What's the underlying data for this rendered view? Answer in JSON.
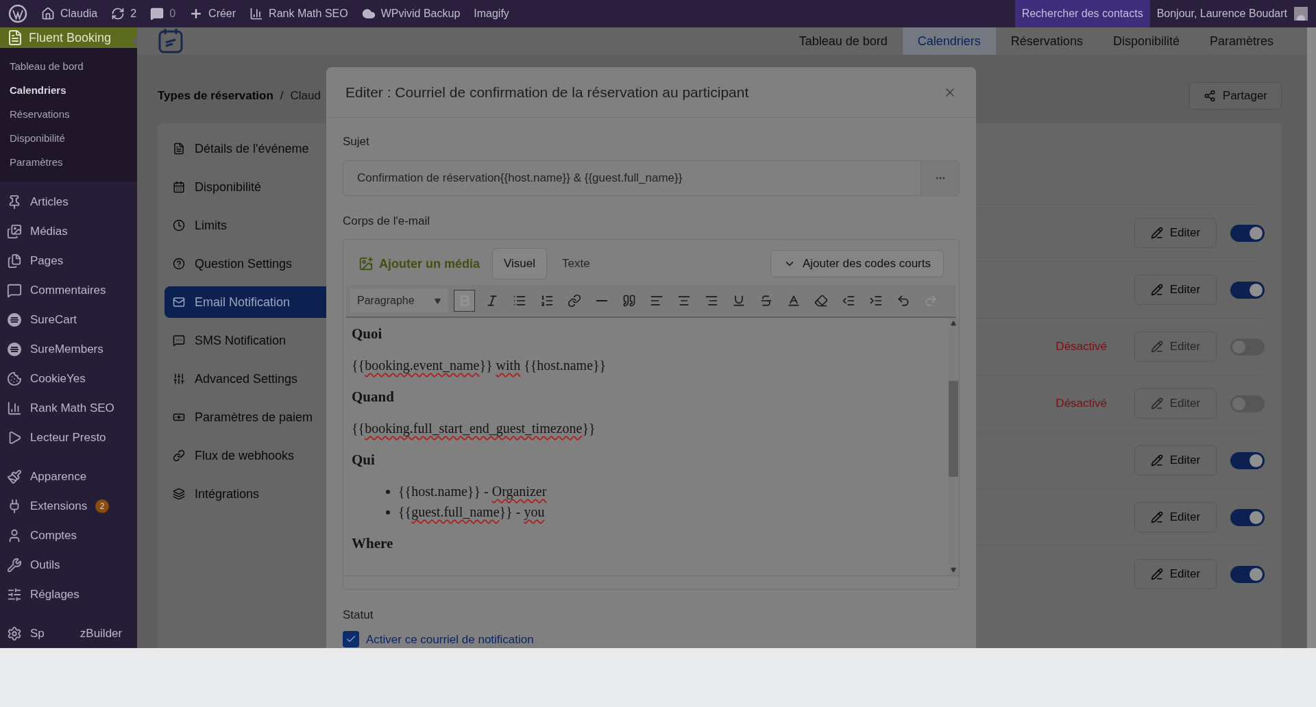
{
  "admin_bar": {
    "site": "Claudia",
    "updates": "2",
    "comments": "0",
    "create": "Créer",
    "plugins": [
      "Rank Math SEO",
      "WPvivid Backup",
      "Imagify"
    ],
    "search_contacts": "Rechercher des contacts",
    "greeting": "Bonjour, Laurence Boudart"
  },
  "sidebar": {
    "plugin": "Fluent Booking",
    "submenu": [
      {
        "label": "Tableau de bord",
        "selected": false
      },
      {
        "label": "Calendriers",
        "selected": true
      },
      {
        "label": "Réservations",
        "selected": false
      },
      {
        "label": "Disponibilité",
        "selected": false
      },
      {
        "label": "Paramètres",
        "selected": false
      }
    ],
    "menu": [
      {
        "label": "Articles"
      },
      {
        "label": "Médias"
      },
      {
        "label": "Pages"
      },
      {
        "label": "Commentaires"
      },
      {
        "label": "SureCart"
      },
      {
        "label": "SureMembers"
      },
      {
        "label": "CookieYes"
      },
      {
        "label": "Rank Math SEO"
      },
      {
        "label": "Lecteur Presto"
      },
      {
        "label": "Apparence"
      },
      {
        "label": "Extensions",
        "badge": "2"
      },
      {
        "label": "Comptes"
      },
      {
        "label": "Outils"
      },
      {
        "label": "Réglages"
      },
      {
        "label": "Sp",
        "label_end": "zBuilder"
      }
    ]
  },
  "app_nav": [
    {
      "label": "Tableau de bord",
      "selected": false
    },
    {
      "label": "Calendriers",
      "selected": true
    },
    {
      "label": "Réservations",
      "selected": false
    },
    {
      "label": "Disponibilité",
      "selected": false
    },
    {
      "label": "Paramètres",
      "selected": false
    }
  ],
  "breadcrumb": {
    "root": "Types de réservation",
    "separator": "/",
    "current": "Claud"
  },
  "share_button": "Partager",
  "settings_menu": [
    {
      "label": "Détails de l'événeme",
      "selected": false
    },
    {
      "label": "Disponibilité",
      "selected": false
    },
    {
      "label": "Limits",
      "selected": false
    },
    {
      "label": "Question Settings",
      "selected": false
    },
    {
      "label": "Email Notification",
      "selected": true
    },
    {
      "label": "SMS Notification",
      "selected": false
    },
    {
      "label": "Advanced Settings",
      "selected": false
    },
    {
      "label": "Paramètres de paiem",
      "selected": false
    },
    {
      "label": "Flux de webhooks",
      "selected": false
    },
    {
      "label": "Intégrations",
      "selected": false
    }
  ],
  "notifications": [
    {
      "edit": "Editer",
      "enabled": true
    },
    {
      "edit": "Editer",
      "enabled": true
    },
    {
      "status": "Désactivé",
      "edit": "Editer",
      "enabled": false
    },
    {
      "status": "Désactivé",
      "edit": "Editer",
      "enabled": false
    },
    {
      "edit": "Editer",
      "enabled": true
    },
    {
      "edit": "Editer",
      "enabled": true
    },
    {
      "edit": "Editer",
      "enabled": true
    }
  ],
  "modal": {
    "title": "Editer : Courriel de confirmation de la réservation au participant",
    "subject_label": "Sujet",
    "subject_value": "Confirmation de réservation{{host.name}} & {{guest.full_name}}",
    "body_label": "Corps de l'e-mail",
    "media_button": "Ajouter un média",
    "editor_tabs": [
      {
        "label": "Visuel",
        "selected": true
      },
      {
        "label": "Texte",
        "selected": false
      }
    ],
    "shortcodes_button": "Ajouter des codes courts",
    "format_select": "Paragraphe",
    "toolbar": [
      {
        "kind": "bold",
        "pressed": true,
        "disabled": true
      },
      {
        "kind": "italic",
        "pressed": false,
        "disabled": false
      },
      {
        "kind": "bullets",
        "pressed": false,
        "disabled": false
      },
      {
        "kind": "numbers",
        "pressed": false,
        "disabled": false
      },
      {
        "kind": "link",
        "pressed": false,
        "disabled": false
      },
      {
        "kind": "rule",
        "pressed": false,
        "disabled": false
      },
      {
        "kind": "quote",
        "pressed": false,
        "disabled": false
      },
      {
        "kind": "align-left",
        "pressed": false,
        "disabled": false
      },
      {
        "kind": "align-center",
        "pressed": false,
        "disabled": false
      },
      {
        "kind": "align-right",
        "pressed": false,
        "disabled": false
      },
      {
        "kind": "underline",
        "pressed": false,
        "disabled": false
      },
      {
        "kind": "strike",
        "pressed": false,
        "disabled": false
      },
      {
        "kind": "text-color",
        "pressed": false,
        "disabled": false
      },
      {
        "kind": "eraser",
        "pressed": false,
        "disabled": false
      },
      {
        "kind": "outdent",
        "pressed": false,
        "disabled": false
      },
      {
        "kind": "indent",
        "pressed": false,
        "disabled": false
      },
      {
        "kind": "undo",
        "pressed": false,
        "disabled": false
      },
      {
        "kind": "redo",
        "pressed": false,
        "disabled": true
      }
    ],
    "content": [
      {
        "kind": "heading",
        "text": "Quoi"
      },
      {
        "kind": "paragraph",
        "segments": [
          {
            "text": "{{",
            "misspelled": false
          },
          {
            "text": "booking.event_name",
            "misspelled": true
          },
          {
            "text": "}} ",
            "misspelled": false
          },
          {
            "text": "with",
            "misspelled": true
          },
          {
            "text": " {{host.name}}",
            "misspelled": false
          }
        ]
      },
      {
        "kind": "heading",
        "text": "Quand"
      },
      {
        "kind": "paragraph",
        "segments": [
          {
            "text": "{{",
            "misspelled": false
          },
          {
            "text": "booking.full_start_end_guest_timezone",
            "misspelled": true
          },
          {
            "text": "}}",
            "misspelled": false
          }
        ]
      },
      {
        "kind": "heading",
        "text": "Qui"
      },
      {
        "kind": "list",
        "items": [
          [
            {
              "text": "{{host.name}} - ",
              "misspelled": false
            },
            {
              "text": "Organizer",
              "misspelled": true
            }
          ],
          [
            {
              "text": "{{",
              "misspelled": false
            },
            {
              "text": "guest.full_name",
              "misspelled": true
            },
            {
              "text": "}} - ",
              "misspelled": false
            },
            {
              "text": "you",
              "misspelled": true
            }
          ]
        ]
      },
      {
        "kind": "heading",
        "text": "Where"
      }
    ],
    "status_label": "Statut",
    "status_checkbox": {
      "label": "Activer ce courriel de notification",
      "checked": true
    }
  }
}
